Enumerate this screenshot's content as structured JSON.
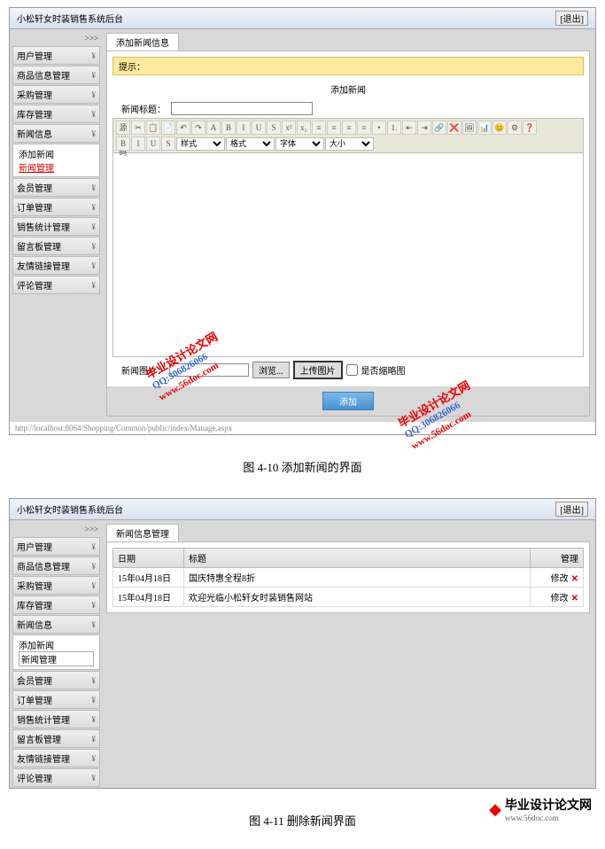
{
  "panel1": {
    "title": "小松轩女时装销售系统后台",
    "logout": "[退出]",
    "collapse": ">>>",
    "sidebar": [
      "用户管理",
      "商品信息管理",
      "采购管理",
      "库存管理",
      "新闻信息",
      "会员管理",
      "订单管理",
      "销售统计管理",
      "留言板管理",
      "友情链接管理",
      "评论管理"
    ],
    "subitems": {
      "add": "添加新闻",
      "manage": "新闻管理"
    },
    "tab": "添加新闻信息",
    "yellowbar": "提示：",
    "section_title": "添加新闻",
    "field_title": "新闻标题：",
    "editor_buttons": [
      "源代码",
      "✂",
      "📋",
      "📄",
      "↶",
      "↷",
      "A",
      "B",
      "I",
      "U",
      "S",
      "x²",
      "x₂",
      "≡",
      "≡",
      "≡",
      "≡",
      "•",
      "1.",
      "⇤",
      "⇥",
      "🔗",
      "❌",
      "🖼",
      "📊",
      "😊",
      "⚙",
      "❓"
    ],
    "editor_selects": [
      "样式",
      "格式",
      "字体",
      "大小"
    ],
    "field_img": "新闻图片：",
    "browse": "浏览...",
    "upload": "上传图片",
    "thumb_check": "是否缩略图",
    "submit": "添加",
    "status_url": "http://localhost:8064/Shopping/Common/public/index/Manage.aspx"
  },
  "caption1": "图 4-10 添加新闻的界面",
  "watermarks": {
    "url": "www.56doc.com",
    "qq": "QQ:306826066",
    "name": "毕业设计论文网"
  },
  "panel2": {
    "title": "小松轩女时装销售系统后台",
    "logout": "[退出]",
    "collapse": ">>>",
    "sidebar": [
      "用户管理",
      "商品信息管理",
      "采购管理",
      "库存管理",
      "新闻信息",
      "会员管理",
      "订单管理",
      "销售统计管理",
      "留言板管理",
      "友情链接管理",
      "评论管理"
    ],
    "subitems": {
      "add": "添加新闻",
      "manage": "新闻管理"
    },
    "tab": "新闻信息管理",
    "cols": {
      "date": "日期",
      "title": "标题",
      "mgmt": "管理"
    },
    "rows": [
      {
        "date": "15年04月18日",
        "title": "国庆特惠全程8折",
        "action": "修改"
      },
      {
        "date": "15年04月18日",
        "title": "欢迎光临小松轩女时装销售网站",
        "action": "修改"
      }
    ]
  },
  "caption2": "图 4-11 删除新闻界面",
  "footer": {
    "name": "毕业设计论文网",
    "url": "www.56doc.com"
  }
}
